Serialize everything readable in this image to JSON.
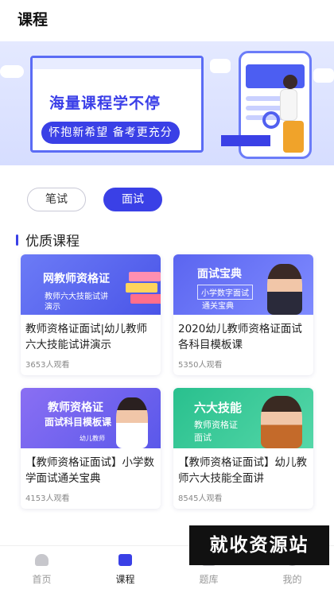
{
  "header": {
    "title": "课程"
  },
  "banner": {
    "headline": "海量课程学不停",
    "subline": "怀抱新希望 备考更充分"
  },
  "tabs": [
    {
      "label": "笔试",
      "active": false
    },
    {
      "label": "面试",
      "active": true
    }
  ],
  "section": {
    "title": "优质课程"
  },
  "courses": [
    {
      "thumb_title": "网教师资格证",
      "thumb_sub": "教师六大技能试讲",
      "thumb_sub2": "演示",
      "title": "教师资格证面试|幼儿教师六大技能试讲演示",
      "views": "3653人观看"
    },
    {
      "thumb_title": "面试宝典",
      "thumb_sub": "小学数字面试",
      "thumb_sub2": "通关宝典",
      "title": "2020幼儿教师资格证面试各科目模板课",
      "views": "5350人观看"
    },
    {
      "thumb_title": "教师资格证",
      "thumb_sub": "面试科目模板课",
      "thumb_sub2": "幼儿教师",
      "title": "【教师资格证面试】小学数学面试通关宝典",
      "views": "4153人观看"
    },
    {
      "thumb_title": "六大技能",
      "thumb_sub": "教师资格证",
      "thumb_sub2": "面试",
      "title": "【教师资格证面试】幼儿教师六大技能全面讲",
      "views": "8545人观看"
    }
  ],
  "bottom_nav": [
    {
      "label": "首页",
      "icon": "home-icon",
      "active": false
    },
    {
      "label": "课程",
      "icon": "course-icon",
      "active": true
    },
    {
      "label": "题库",
      "icon": "question-bank-icon",
      "active": false
    },
    {
      "label": "我的",
      "icon": "profile-icon",
      "active": false
    }
  ],
  "watermark": "就收资源站",
  "colors": {
    "accent": "#3a40e6",
    "green": "#29c08e"
  }
}
